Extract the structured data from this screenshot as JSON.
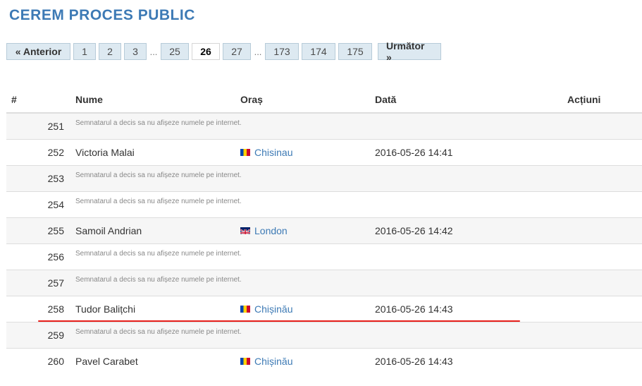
{
  "page": {
    "title": "CEREM PROCES PUBLIC"
  },
  "pagination": {
    "prev_label": "« Anterior",
    "next_label": "Următor »",
    "ellipsis": "...",
    "pages_first": [
      "1",
      "2",
      "3"
    ],
    "pages_middle": [
      "25",
      "26",
      "27"
    ],
    "pages_last": [
      "173",
      "174",
      "175"
    ],
    "active_page": "26"
  },
  "table": {
    "headers": {
      "num": "#",
      "name": "Nume",
      "city": "Oraș",
      "date": "Dată",
      "actions": "Acțiuni"
    },
    "rows": [
      {
        "num": "251",
        "note": "Semnatarul a decis sa nu afișeze numele pe internet."
      },
      {
        "num": "252",
        "name": "Victoria Malai",
        "city": "Chisinau",
        "flag": "moldova-flag",
        "date": "2016-05-26 14:41"
      },
      {
        "num": "253",
        "note": "Semnatarul a decis sa nu afișeze numele pe internet."
      },
      {
        "num": "254",
        "note": "Semnatarul a decis sa nu afișeze numele pe internet."
      },
      {
        "num": "255",
        "name": "Samoil Andrian",
        "city": "London",
        "flag": "uk-flag",
        "date": "2016-05-26 14:42"
      },
      {
        "num": "256",
        "note": "Semnatarul a decis sa nu afișeze numele pe internet."
      },
      {
        "num": "257",
        "note": "Semnatarul a decis sa nu afișeze numele pe internet."
      },
      {
        "num": "258",
        "name": "Tudor Balițchi",
        "city": "Chișinău",
        "flag": "moldova-flag",
        "date": "2016-05-26 14:43"
      },
      {
        "num": "259",
        "note": "Semnatarul a decis sa nu afișeze numele pe internet."
      },
      {
        "num": "260",
        "name": "Pavel Carabet",
        "city": "Chișinău",
        "flag": "moldova-flag",
        "date": "2016-05-26 14:43"
      }
    ]
  },
  "colors": {
    "accent": "#3d7ab5",
    "highlight_line": "#e8201c",
    "button_bg": "#dde9f1"
  }
}
